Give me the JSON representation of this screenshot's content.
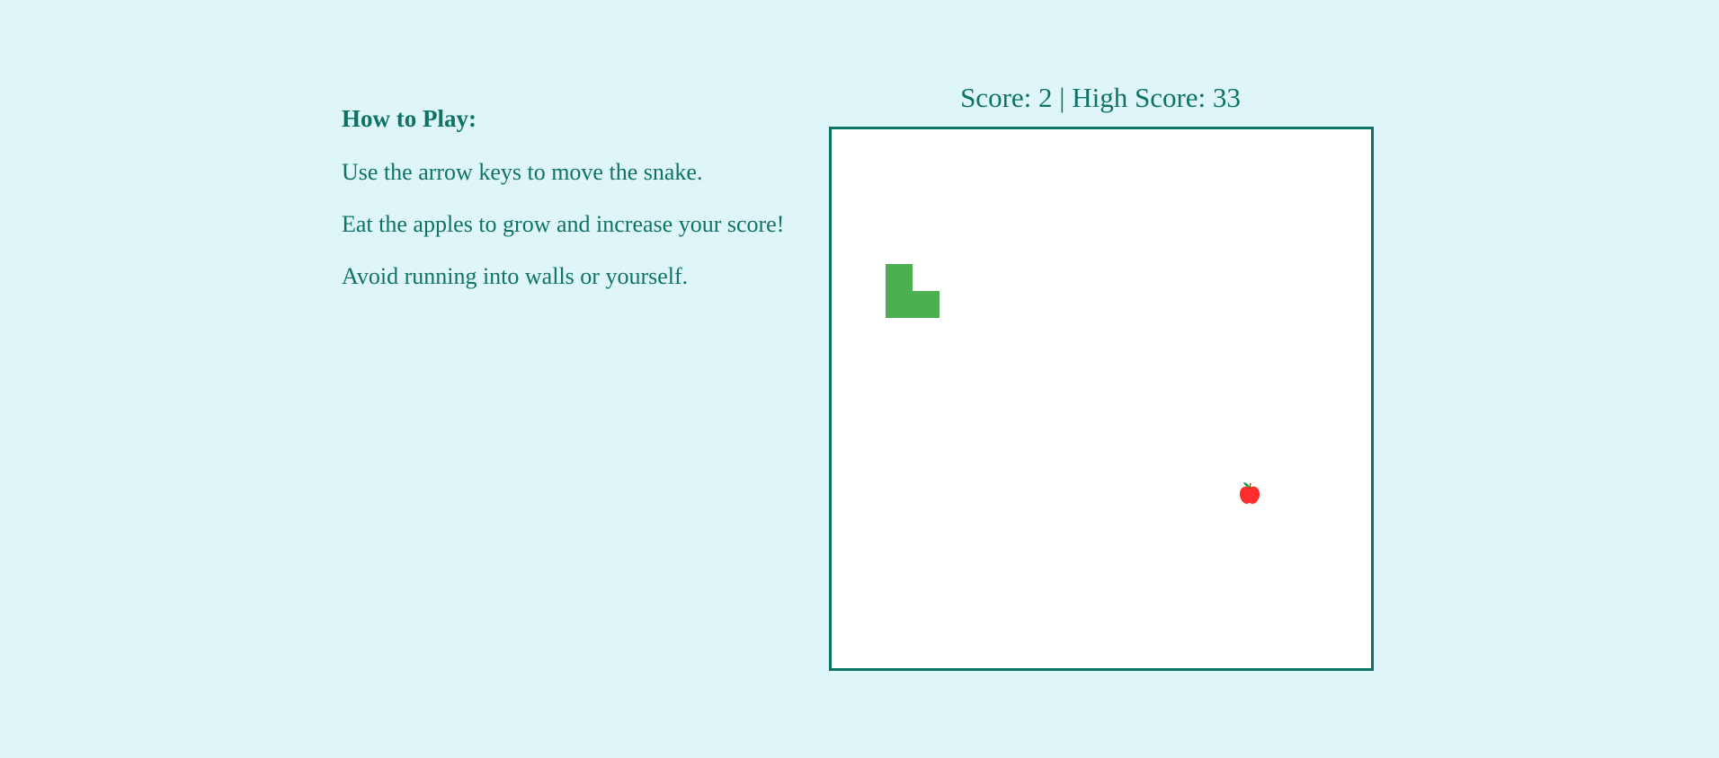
{
  "instructions": {
    "title": "How to Play:",
    "lines": [
      "Use the arrow keys to move the snake.",
      "Eat the apples to grow and increase your score!",
      "Avoid running into walls or yourself."
    ]
  },
  "score": {
    "text": "Score: 2 | High Score: 33",
    "current": 2,
    "high": 33
  },
  "board": {
    "grid_cells": 20,
    "snake": [
      {
        "col": 2,
        "row": 5
      },
      {
        "col": 2,
        "row": 6
      },
      {
        "col": 3,
        "row": 6
      }
    ],
    "apple": {
      "col": 15,
      "row": 13
    }
  },
  "colors": {
    "background": "#dff6f9",
    "text": "#0e7366",
    "board_border": "#0e7366",
    "snake": "#4caf50",
    "apple": "#ff2d2d",
    "apple_leaf": "#1aa84a"
  },
  "icons": {
    "apple": "apple-icon"
  }
}
